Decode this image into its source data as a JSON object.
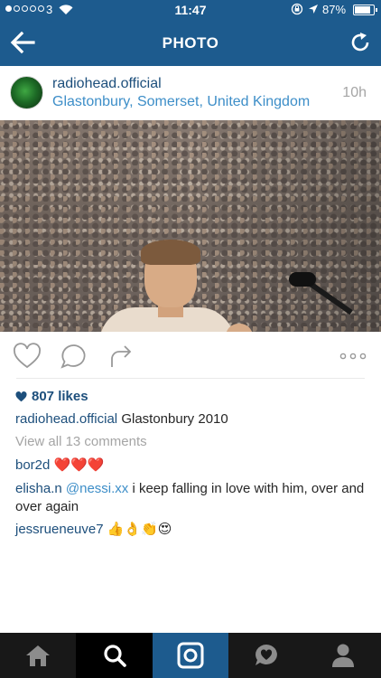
{
  "status_bar": {
    "carrier": "3",
    "time": "11:47",
    "battery_percent": "87%",
    "battery_level": 0.87,
    "signal_bars": 1
  },
  "nav": {
    "title": "PHOTO",
    "back_icon": "arrow-left-icon",
    "refresh_icon": "refresh-icon"
  },
  "post": {
    "username": "radiohead.official",
    "location": "Glastonbury, Somerset, United Kingdom",
    "time_ago": "10h",
    "likes": "807 likes",
    "caption": {
      "user": "radiohead.official",
      "text": "Glastonbury 2010"
    },
    "view_comments": "View all 13 comments",
    "comments": [
      {
        "user": "bor2d",
        "text": "❤️❤️❤️"
      },
      {
        "user": "elisha.n",
        "mention": "@nessi.xx",
        "text": "i keep falling in love with him, over and over again"
      },
      {
        "user": "jessrueneuve7",
        "text": "👍👌👏😍"
      }
    ]
  },
  "actions": [
    "heart-icon",
    "comment-icon",
    "share-icon",
    "more-icon"
  ],
  "tabbar": [
    "home-icon",
    "search-icon",
    "camera-icon",
    "activity-icon",
    "profile-icon"
  ],
  "colors": {
    "header": "#1d5b8e",
    "username": "#1d4f7c",
    "link": "#3d8ec8",
    "muted": "#a5a5a5",
    "tabbar": "#181818"
  }
}
